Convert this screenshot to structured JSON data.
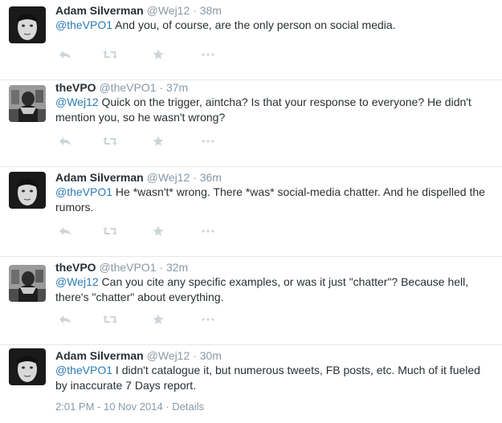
{
  "tweets": [
    {
      "author": "Adam Silverman",
      "handle": "@Wej12",
      "separator": "·",
      "time": "38m",
      "mention": "@theVPO1",
      "body": " And you, of course, are the only person on social media.",
      "avatar": "adam-avatar"
    },
    {
      "author": "theVPO",
      "handle": "@theVPO1",
      "separator": "·",
      "time": "37m",
      "mention": "@Wej12",
      "body": " Quick on the trigger, aintcha? Is that your response to everyone? He didn't mention you, so he wasn't wrong?",
      "avatar": "vpo-avatar"
    },
    {
      "author": "Adam Silverman",
      "handle": "@Wej12",
      "separator": "·",
      "time": "36m",
      "mention": "@theVPO1",
      "body": " He *wasn't* wrong. There *was* social-media chatter. And he dispelled the rumors.",
      "avatar": "adam-avatar"
    },
    {
      "author": "theVPO",
      "handle": "@theVPO1",
      "separator": "·",
      "time": "32m",
      "mention": "@Wej12",
      "body": " Can you cite any specific examples, or was it just \"chatter\"? Because hell, there's \"chatter\" about everything.",
      "avatar": "vpo-avatar"
    },
    {
      "author": "Adam Silverman",
      "handle": "@Wej12",
      "separator": "·",
      "time": "30m",
      "mention": "@theVPO1",
      "body": " I didn't catalogue it, but numerous tweets, FB posts, etc. Much of it fueled by inaccurate 7 Days report.",
      "avatar": "adam-avatar"
    }
  ],
  "action_icons": [
    "reply-icon",
    "retweet-icon",
    "favorite-icon",
    "more-icon"
  ],
  "footer": {
    "timestamp": "2:01 PM - 10 Nov 2014",
    "separator": "·",
    "details": "Details"
  },
  "colors": {
    "link": "#2b7bb9",
    "muted": "#8899a6",
    "text": "#292f33",
    "action": "#cdd4da"
  }
}
